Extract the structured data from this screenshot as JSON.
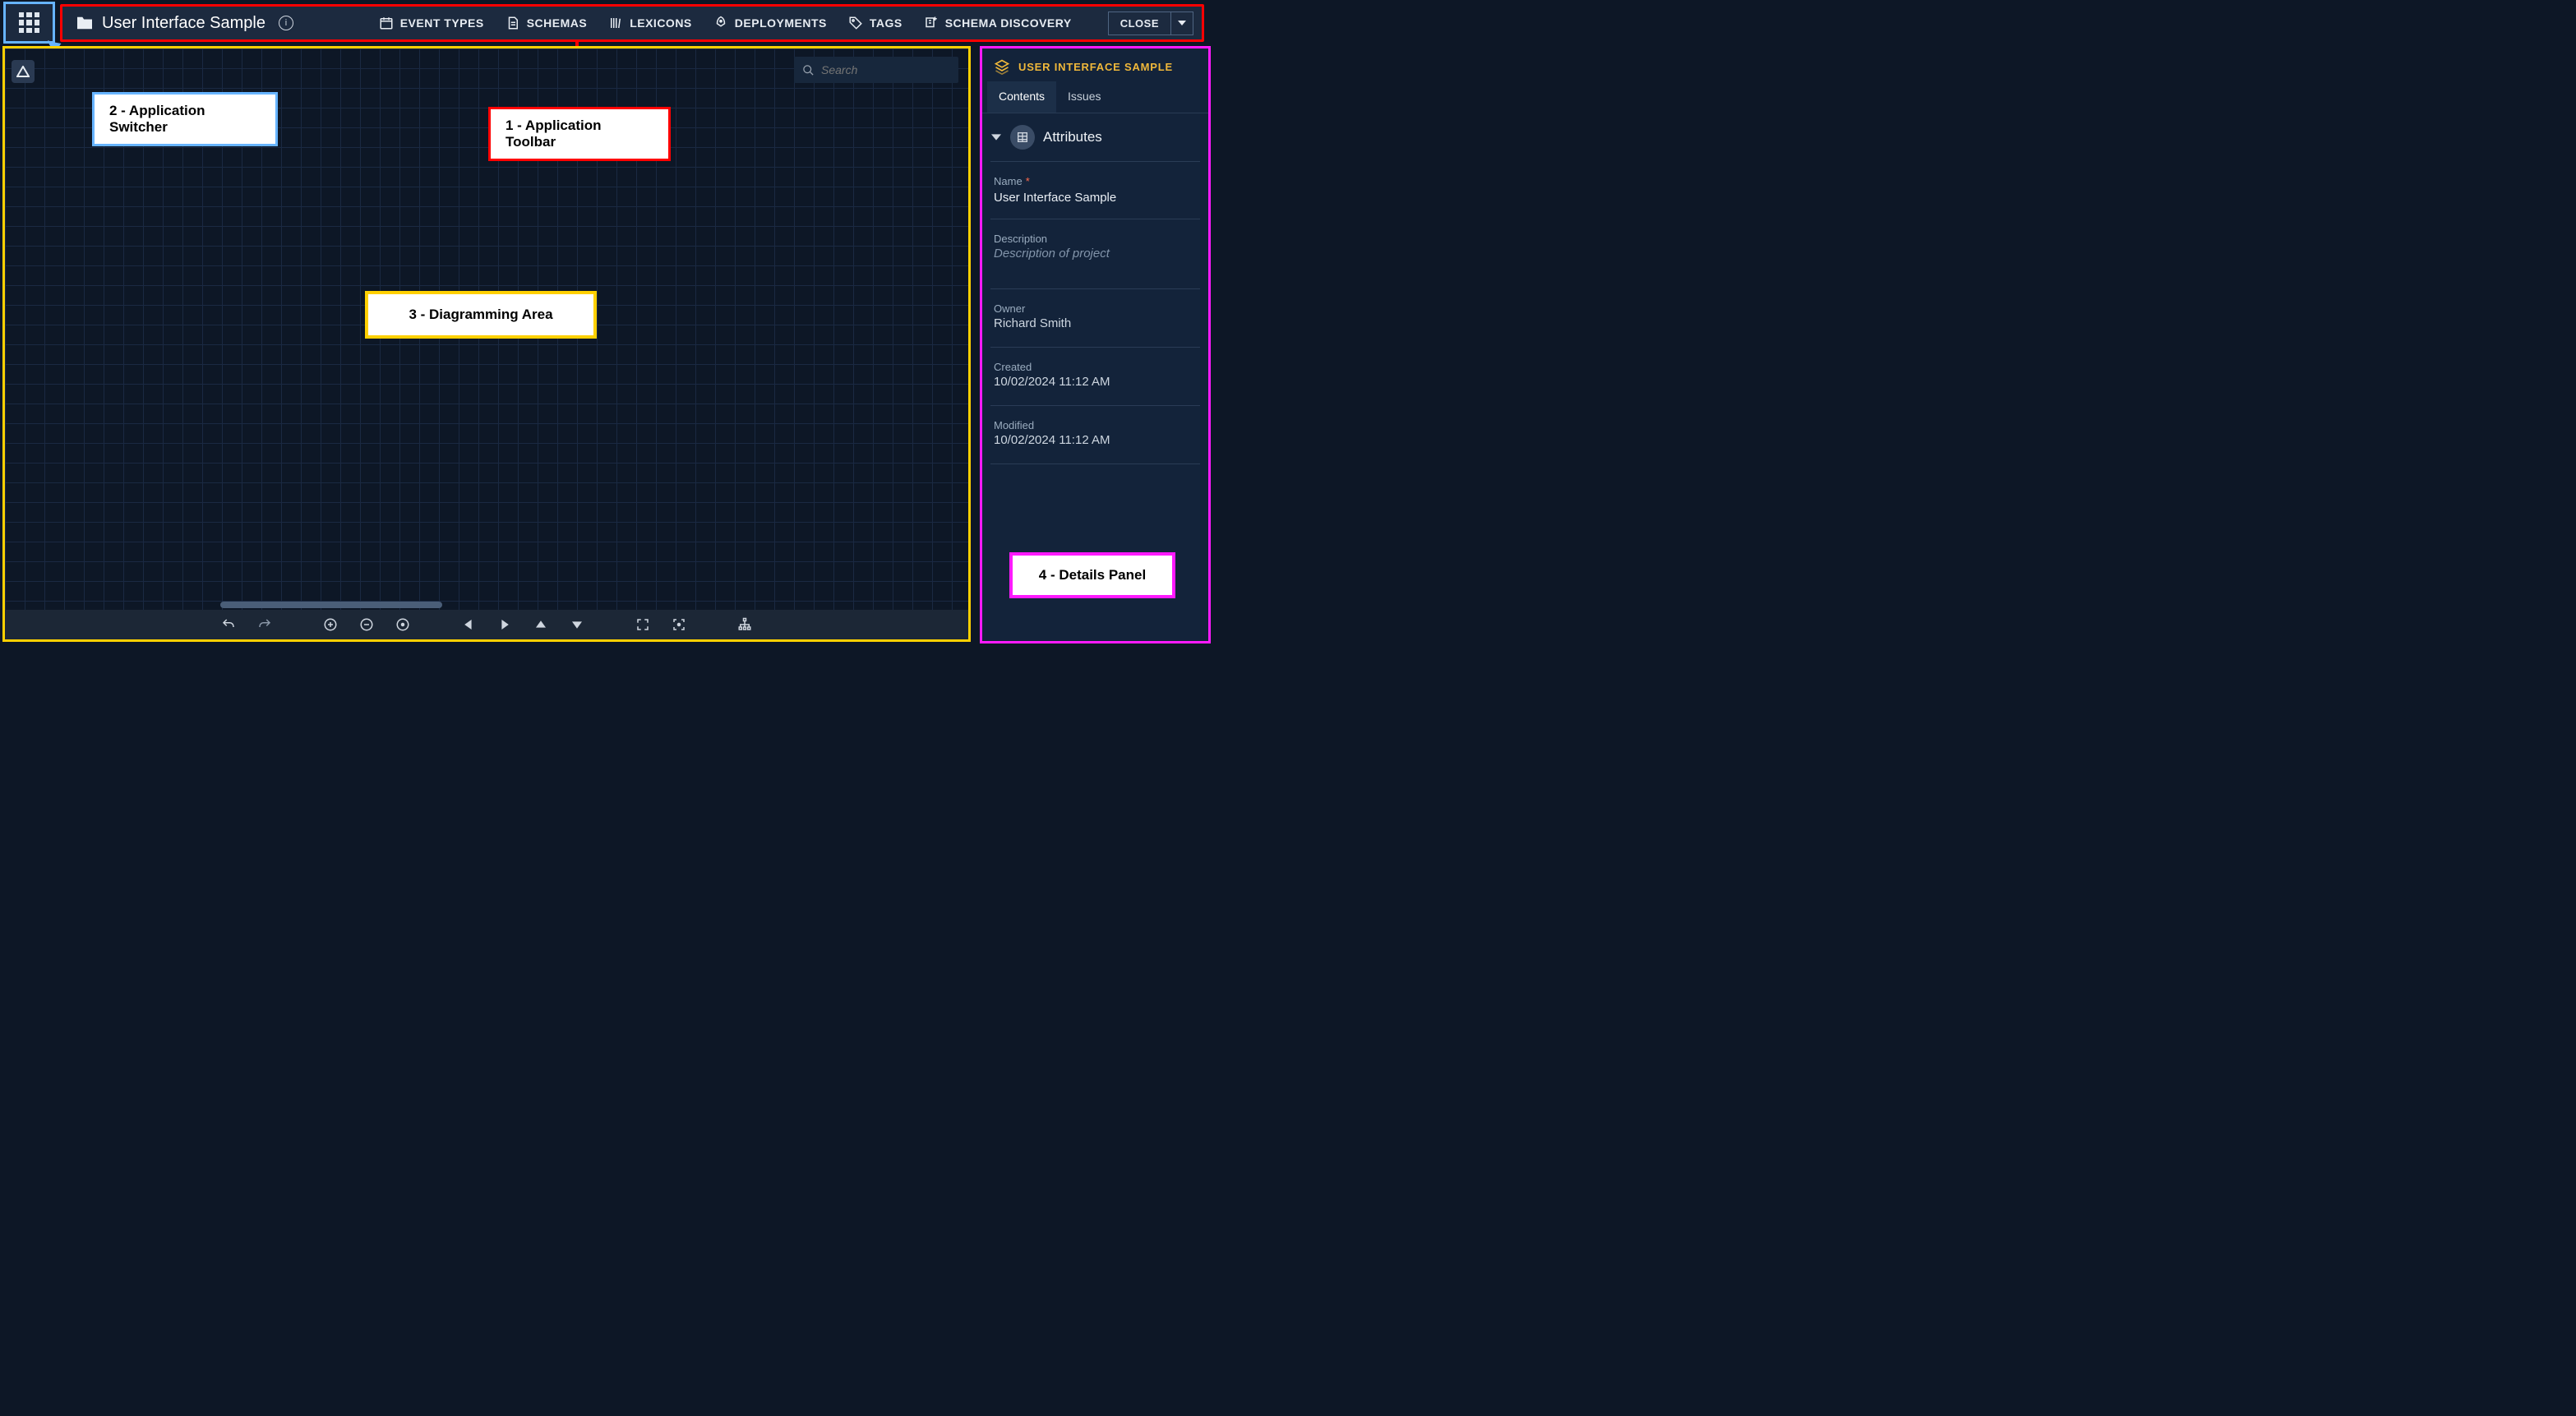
{
  "toolbar": {
    "title": "User Interface Sample",
    "nav": {
      "event_types": "EVENT TYPES",
      "schemas": "SCHEMAS",
      "lexicons": "LEXICONS",
      "deployments": "DEPLOYMENTS",
      "tags": "TAGS",
      "schema_discovery": "SCHEMA DISCOVERY"
    },
    "close_label": "CLOSE"
  },
  "search": {
    "placeholder": "Search"
  },
  "callouts": {
    "toolbar": "1 - Application Toolbar",
    "switcher": "2 - Application Switcher",
    "diagram": "3 - Diagramming Area",
    "details": "4 - Details Panel"
  },
  "details": {
    "title": "USER INTERFACE SAMPLE",
    "tabs": {
      "contents": "Contents",
      "issues": "Issues"
    },
    "section_attributes": "Attributes",
    "fields": {
      "name_label": "Name",
      "name_value": "User Interface Sample",
      "desc_label": "Description",
      "desc_placeholder": "Description of project",
      "owner_label": "Owner",
      "owner_value": "Richard Smith",
      "created_label": "Created",
      "created_value": "10/02/2024 11:12 AM",
      "modified_label": "Modified",
      "modified_value": "10/02/2024 11:12 AM"
    }
  },
  "icons": {
    "info": "i"
  }
}
